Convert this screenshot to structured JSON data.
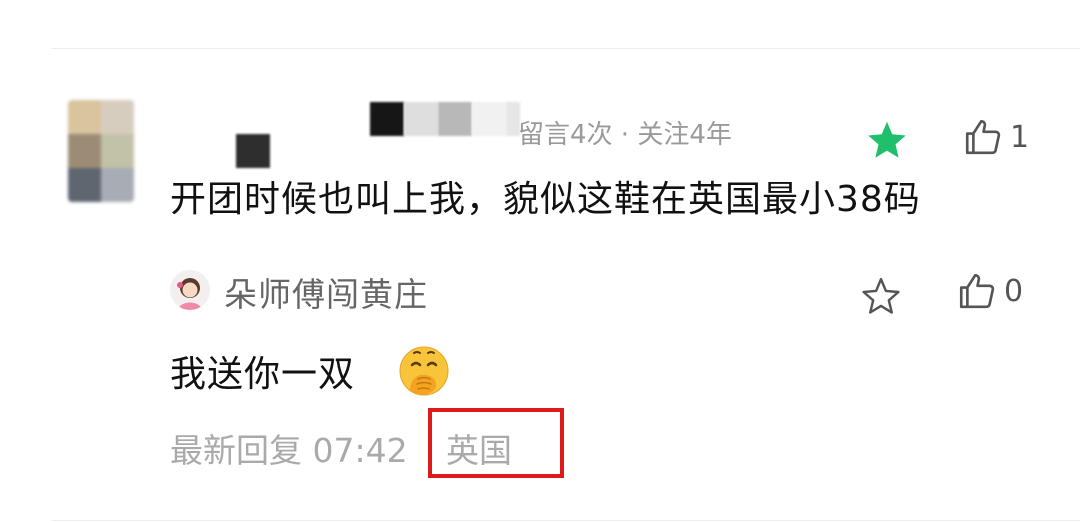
{
  "comment": {
    "meta": "留言4次 · 关注4年",
    "text": "开团时候也叫上我，貌似这鞋在英国最小38码",
    "star_state": "starred",
    "star_color": "#1fbf6b",
    "like_count": "1"
  },
  "reply": {
    "author": "朵师傅闯黄庄",
    "text": "我送你一双",
    "emoji": "hand-over-mouth-emoji",
    "star_state": "unstarred",
    "like_count": "0",
    "footer_label": "最新回复 07:42",
    "location": "英国"
  },
  "colors": {
    "highlight": "#e01818",
    "muted_text": "#aaaaaa"
  }
}
